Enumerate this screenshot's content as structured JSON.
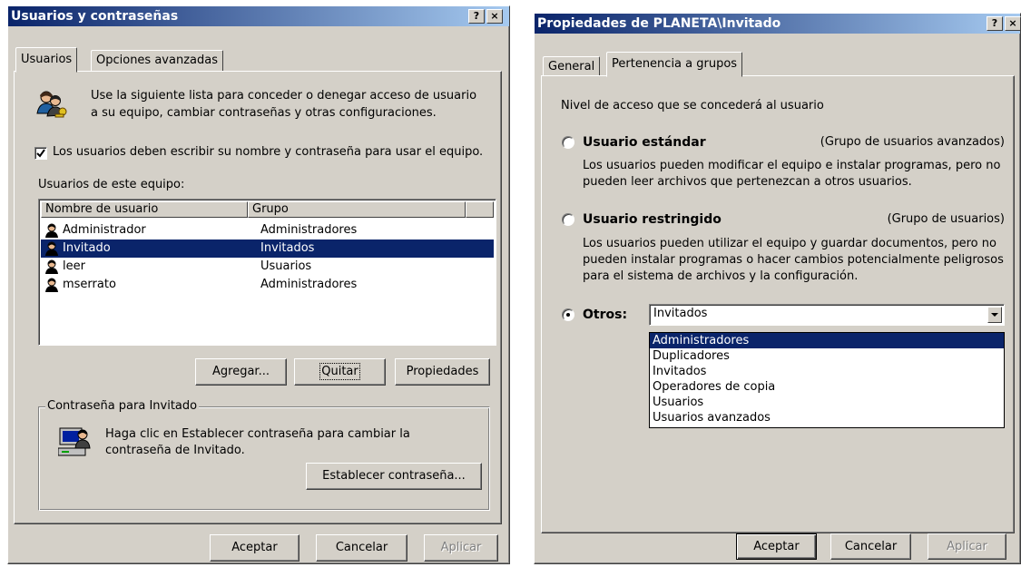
{
  "left_dialog": {
    "title": "Usuarios y contraseñas",
    "title_buttons": {
      "help": "?",
      "close": "×"
    },
    "tabs": [
      "Usuarios",
      "Opciones avanzadas"
    ],
    "intro_line1": "Use la siguiente lista para conceder o denegar acceso de usuario",
    "intro_line2": "a su equipo, cambiar contraseñas y otras configuraciones.",
    "checkbox_label": "Los usuarios deben escribir su nombre y contraseña para usar el equipo.",
    "checkbox_checked": true,
    "list_label": "Usuarios de este equipo:",
    "columns": [
      "Nombre de usuario",
      "Grupo"
    ],
    "users": [
      {
        "name": "Administrador",
        "group": "Administradores",
        "selected": false
      },
      {
        "name": "Invitado",
        "group": "Invitados",
        "selected": true
      },
      {
        "name": "leer",
        "group": "Usuarios",
        "selected": false
      },
      {
        "name": "mserrato",
        "group": "Administradores",
        "selected": false
      }
    ],
    "buttons": {
      "add": "Agregar...",
      "remove": "Quitar",
      "properties": "Propiedades"
    },
    "password_group": {
      "label": "Contraseña para Invitado",
      "text_line1": "Haga clic en Establecer contraseña para cambiar la",
      "text_line2": "contraseña de Invitado.",
      "button": "Establecer contraseña..."
    },
    "footer": {
      "ok": "Aceptar",
      "cancel": "Cancelar",
      "apply": "Aplicar"
    }
  },
  "right_dialog": {
    "title": "Propiedades de PLANETA\\Invitado",
    "title_buttons": {
      "help": "?",
      "close": "×"
    },
    "tabs": [
      "General",
      "Pertenencia a grupos"
    ],
    "access_label": "Nivel de acceso que se concederá al usuario",
    "options": [
      {
        "label": "Usuario estándar",
        "group_hint": "(Grupo de usuarios avanzados)",
        "desc_line1": "Los usuarios pueden modificar el equipo e instalar programas, pero no",
        "desc_line2": "pueden leer archivos que pertenezcan a otros usuarios.",
        "desc_line3": "",
        "selected": false
      },
      {
        "label": "Usuario restringido",
        "group_hint": "(Grupo de usuarios)",
        "desc_line1": "Los usuarios pueden utilizar el equipo y guardar documentos, pero no",
        "desc_line2": "pueden instalar programas o hacer cambios potencialmente peligrosos",
        "desc_line3": "para el sistema de archivos y la configuración.",
        "selected": false
      }
    ],
    "other_label": "Otros:",
    "other_selected": true,
    "combo_value": "Invitados",
    "dropdown_options": [
      "Administradores",
      "Duplicadores",
      "Invitados",
      "Operadores de copia",
      "Usuarios",
      "Usuarios avanzados"
    ],
    "dropdown_highlighted": "Administradores",
    "footer": {
      "ok": "Aceptar",
      "cancel": "Cancelar",
      "apply": "Aplicar"
    }
  },
  "colors": {
    "selection": "#0a246a",
    "dialog_face": "#d4d0c8",
    "title_start": "#0a246a",
    "title_end": "#a6caf0"
  }
}
